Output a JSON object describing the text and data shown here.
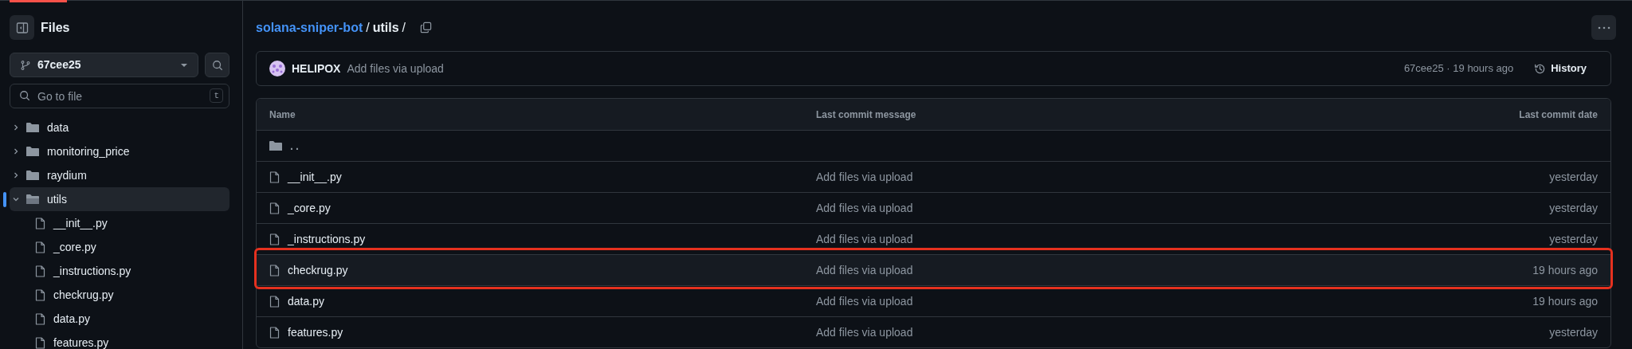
{
  "sidebar": {
    "title": "Files",
    "branch": "67cee25",
    "search": {
      "placeholder": "Go to file",
      "shortcut": "t"
    },
    "tree": [
      {
        "kind": "folder",
        "name": "data",
        "expanded": false,
        "selected": false
      },
      {
        "kind": "folder",
        "name": "monitoring_price",
        "expanded": false,
        "selected": false
      },
      {
        "kind": "folder",
        "name": "raydium",
        "expanded": false,
        "selected": false
      },
      {
        "kind": "folder",
        "name": "utils",
        "expanded": true,
        "selected": true,
        "children": [
          {
            "kind": "file",
            "name": "__init__.py",
            "selected": false
          },
          {
            "kind": "file",
            "name": "_core.py",
            "selected": false
          },
          {
            "kind": "file",
            "name": "_instructions.py",
            "selected": false
          },
          {
            "kind": "file",
            "name": "checkrug.py",
            "selected": false
          },
          {
            "kind": "file",
            "name": "data.py",
            "selected": false
          },
          {
            "kind": "file",
            "name": "features.py",
            "selected": false
          }
        ]
      }
    ]
  },
  "breadcrumb": {
    "repo": "solana-sniper-bot",
    "path": "utils",
    "separators": [
      "/",
      "/"
    ]
  },
  "commit": {
    "author": "HELIPOX",
    "message": "Add files via upload",
    "sha_time": "67cee25 · 19 hours ago",
    "history": "History"
  },
  "table": {
    "columns": [
      "Name",
      "Last commit message",
      "Last commit date"
    ],
    "rows": [
      {
        "kind": "parent",
        "name": "..",
        "highlighted": false
      },
      {
        "kind": "file",
        "name": "__init__.py",
        "message": "Add files via upload",
        "date": "yesterday",
        "highlighted": false
      },
      {
        "kind": "file",
        "name": "_core.py",
        "message": "Add files via upload",
        "date": "yesterday",
        "highlighted": false
      },
      {
        "kind": "file",
        "name": "_instructions.py",
        "message": "Add files via upload",
        "date": "yesterday",
        "highlighted": false
      },
      {
        "kind": "file",
        "name": "checkrug.py",
        "message": "Add files via upload",
        "date": "19 hours ago",
        "highlighted": true
      },
      {
        "kind": "file",
        "name": "data.py",
        "message": "Add files via upload",
        "date": "19 hours ago",
        "highlighted": false
      },
      {
        "kind": "file",
        "name": "features.py",
        "message": "Add files via upload",
        "date": "yesterday",
        "highlighted": false
      }
    ]
  }
}
